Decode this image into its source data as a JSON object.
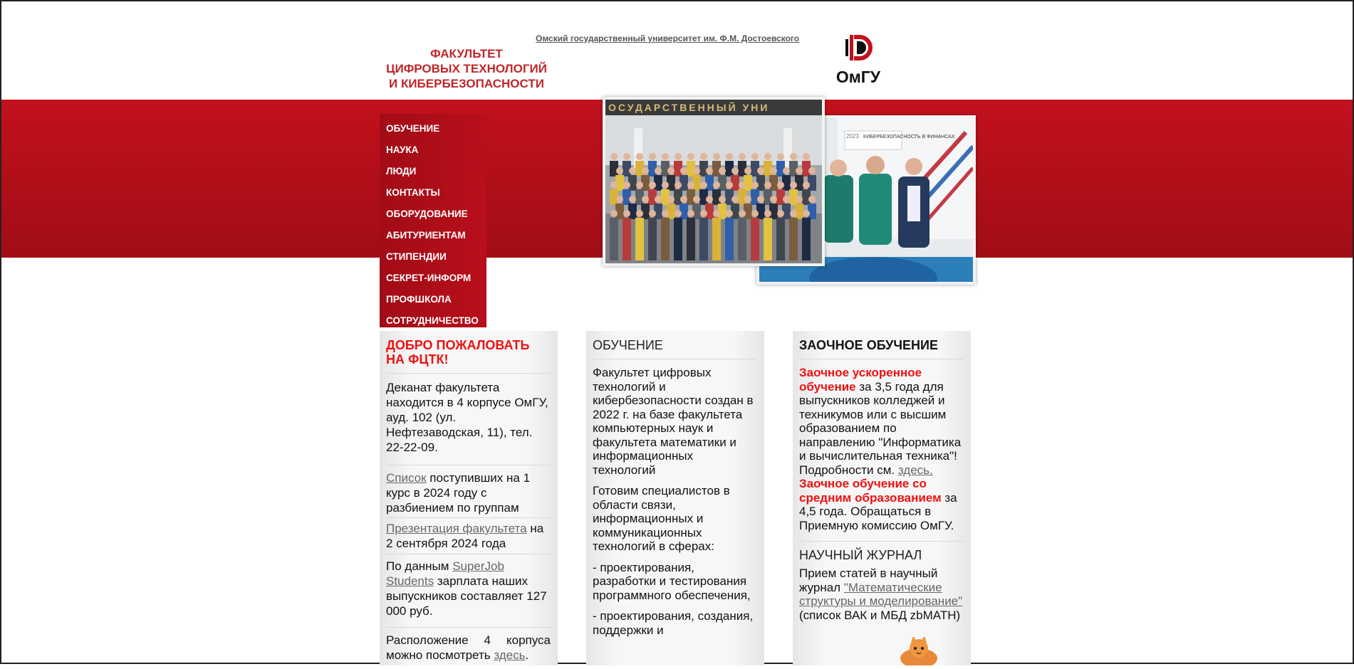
{
  "header": {
    "university_link": "Омский государственный университет им. Ф.М. Достоевского",
    "faculty_title": [
      "ФАКУЛЬТЕТ",
      "ЦИФРОВЫХ ТЕХНОЛОГИЙ",
      "И КИБЕРБЕЗОПАСНОСТИ"
    ],
    "logo_text": "ОмГУ"
  },
  "menu": {
    "items": [
      {
        "label": "ОБУЧЕНИЕ"
      },
      {
        "label": "НАУКА"
      },
      {
        "label": "ЛЮДИ"
      },
      {
        "label": "КОНТАКТЫ"
      },
      {
        "label": "ОБОРУДОВАНИЕ"
      },
      {
        "label": "АБИТУРИЕНТАМ"
      },
      {
        "label": "СТИПЕНДИИ"
      },
      {
        "label": "СЕКРЕТ-ИНФОРМ"
      },
      {
        "label": "ПРОФШКОЛА"
      },
      {
        "label": "СОТРУДНИЧЕСТВО"
      }
    ]
  },
  "photos": {
    "banner_text": "ОСУДАРСТВЕННЫЙ УНИ",
    "poster_year": "2023",
    "poster_text": "КИБЕРБЕЗОПАСНОСТЬ В ФИНАНСАХ"
  },
  "welcome": {
    "title": "ДОБРО ПОЖАЛОВАТЬ НА ФЦТК!",
    "dean_text": "Деканат факультета находится в 4 корпусе ОмГУ, ауд. 102 (ул. Нефтезаводская, 11), тел. 22-22-09.",
    "list_link": "Список",
    "list_text": " поступивших на 1 курс в 2024 году с разбиением по группам",
    "presentation_link": "Презентация факультета",
    "presentation_text": " на 2 сентября 2024 года",
    "superjob_prefix": "По данным ",
    "superjob_link": "SuperJob Students",
    "superjob_text": " зарплата наших выпускников составляет 127 000 руб.",
    "location_text": "Расположение 4 корпуса можно посмотреть ",
    "location_link": "здесь",
    "location_end": "."
  },
  "education": {
    "title": "ОБУЧЕНИЕ",
    "p1": "Факультет цифровых технологий и кибербезопасности создан в 2022 г. на базе факультета компьютерных наук и факультета математики и информационных технологий",
    "p2": "Готовим специалистов в области связи, информационных и коммуникационных технологий в сферах:",
    "p3": "- проектирования, разработки и тестирования программного обеспечения,",
    "p4": "- проектирования, создания, поддержки и"
  },
  "distance": {
    "title": "ЗАОЧНОЕ ОБУЧЕНИЕ",
    "accel_bold": "Заочное ускоренное обучение",
    "accel_text": " за 3,5 года для выпускников колледжей и техникумов или с высшим образованием по направлению \"Информатика и вычислительная техника\"! Подробности см. ",
    "accel_link": "здесь.",
    "secondary_bold": "Заочное обучение со средним образованием",
    "secondary_text": " за 4,5 года. Обращаться в Приемную комиссию ОмГУ."
  },
  "journal": {
    "title": "НАУЧНЫЙ ЖУРНАЛ",
    "text_start": "Прием статей в научный журнал ",
    "link": "\"Математические структуры и моделирование\"",
    "text_end": " (список ВАК и МБД zbMATH)"
  },
  "colors": {
    "brand_red": "#c2111c",
    "menu_red": "#a20c16",
    "title_red": "#c0262a",
    "highlight_red": "#ee1111"
  }
}
